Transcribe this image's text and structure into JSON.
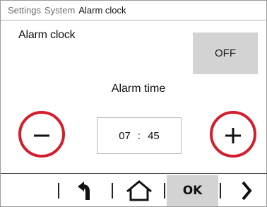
{
  "breadcrumb": [
    "Settings",
    "System",
    "Alarm clock"
  ],
  "alarm": {
    "label": "Alarm clock",
    "toggle_state": "OFF"
  },
  "time": {
    "label": "Alarm time",
    "hours": "07",
    "separator": ":",
    "minutes": "45"
  },
  "controls": {
    "decrement_icon": "minus-icon",
    "increment_icon": "plus-icon",
    "accent_color": "#d21e2d"
  },
  "nav": {
    "back_icon": "back-arrow-icon",
    "home_icon": "home-icon",
    "ok_label": "OK",
    "next_icon": "chevron-right-icon"
  }
}
